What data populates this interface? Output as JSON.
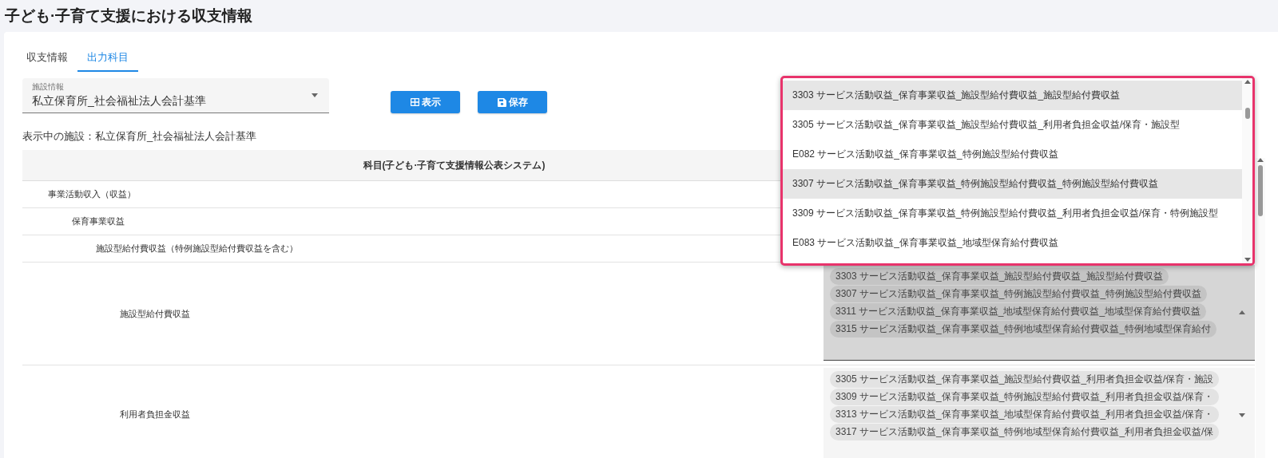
{
  "page_title": "子ども·子育て支援における収支情報",
  "tabs": [
    {
      "label": "収支情報",
      "selected": false
    },
    {
      "label": "出力科目",
      "selected": true
    }
  ],
  "facility_select": {
    "label": "施設情報",
    "value": "私立保育所_社会福祉法人会計基準"
  },
  "buttons": [
    {
      "kind": "display",
      "label": "表示"
    },
    {
      "kind": "save",
      "label": "保存"
    }
  ],
  "current_facility": "表示中の施設：私立保育所_社会福祉法人会計基準",
  "table": {
    "columns": [
      "科目(子ども·子育て支援情報公表システム)"
    ],
    "rows": [
      {
        "label": "事業活動収入（収益）",
        "children": [
          {
            "label": "保育事業収益",
            "children": [
              {
                "label": "施設型給付費収益（特例施設型給付費収益を含む）",
                "children": [
                  {
                    "label": "施設型給付費収益",
                    "expanded": true,
                    "mapped": [
                      "3303 サービス活動収益_保育事業収益_施設型給付費収益_施設型給付費収益",
                      "3307 サービス活動収益_保育事業収益_特例施設型給付費収益_特例施設型給付費収益",
                      "3311 サービス活動収益_保育事業収益_地域型保育給付費収益_地域型保育給付費収益",
                      "3315 サービス活動収益_保育事業収益_特例地域型保育給付費収益_特例地域型保育給付"
                    ]
                  },
                  {
                    "label": "利用者負担金収益",
                    "expanded": false,
                    "mapped": [
                      "3305 サービス活動収益_保育事業収益_施設型給付費収益_利用者負担金収益/保育・施設",
                      "3309 サービス活動収益_保育事業収益_特例施設型給付費収益_利用者負担金収益/保育・",
                      "3313 サービス活動収益_保育事業収益_地域型保育給付費収益_利用者負担金収益/保育・",
                      "3317 サービス活動収益_保育事業収益_特例地域型保育給付費収益_利用者負担金収益/保"
                    ]
                  }
                ]
              }
            ]
          }
        ]
      }
    ]
  },
  "dropdown": {
    "options": [
      {
        "label": "3303 サービス活動収益_保育事業収益_施設型給付費収益_施設型給付費収益",
        "selected": true
      },
      {
        "label": "3305 サービス活動収益_保育事業収益_施設型給付費収益_利用者負担金収益/保育・施設型",
        "selected": false
      },
      {
        "label": "E082 サービス活動収益_保育事業収益_特例施設型給付費収益",
        "selected": false
      },
      {
        "label": "3307 サービス活動収益_保育事業収益_特例施設型給付費収益_特例施設型給付費収益",
        "selected": true
      },
      {
        "label": "3309 サービス活動収益_保育事業収益_特例施設型給付費収益_利用者負担金収益/保育・特例施設型",
        "selected": false
      },
      {
        "label": "E083 サービス活動収益_保育事業収益_地域型保育給付費収益",
        "selected": false
      }
    ]
  }
}
